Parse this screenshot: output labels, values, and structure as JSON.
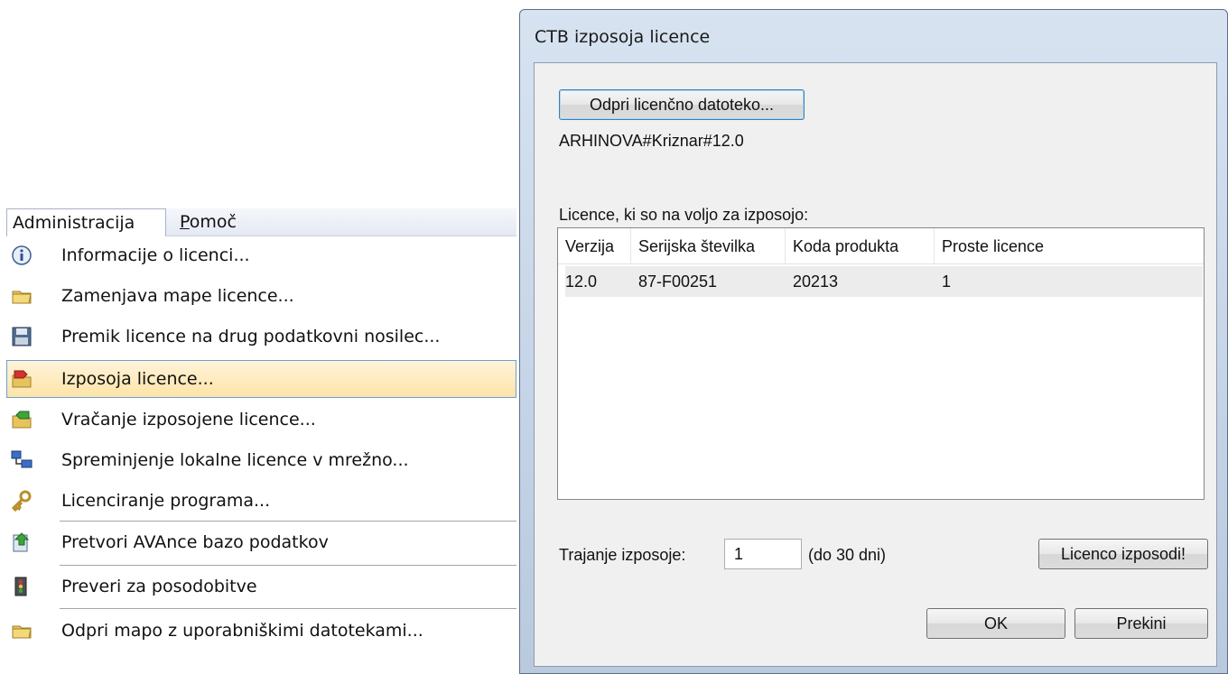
{
  "menubar": {
    "tabs": [
      {
        "label": "Administracija"
      },
      {
        "label_first": "P",
        "label_rest": "omoč"
      }
    ]
  },
  "menu": {
    "items": [
      {
        "label": "Informacije o licenci...",
        "icon": "info-icon"
      },
      {
        "label": "Zamenjava mape licence...",
        "icon": "folder-icon"
      },
      {
        "label": "Premik licence na drug podatkovni nosilec...",
        "icon": "floppy-disk-icon"
      },
      {
        "label": "Izposoja licence...",
        "icon": "folder-red-arrow-icon",
        "highlighted": true
      },
      {
        "label": "Vračanje izposojene licence...",
        "icon": "folder-green-arrow-icon"
      },
      {
        "label": "Spreminjenje lokalne licence v mrežno...",
        "icon": "network-computers-icon"
      },
      {
        "label": "Licenciranje programa...",
        "icon": "key-icon"
      },
      {
        "label": "Pretvori AVAnce bazo podatkov",
        "icon": "convert-database-icon"
      },
      {
        "label": "Preveri za posodobitve",
        "icon": "update-check-icon"
      },
      {
        "label": "Odpri mapo z uporabniškimi datotekami...",
        "icon": "folder-icon"
      }
    ]
  },
  "dialog": {
    "title": "CTB izposoja licence",
    "open_button": "Odpri licenčno datoteko...",
    "license_file": "ARHINOVA#Kriznar#12.0",
    "available_label": "Licence, ki so na voljo za izposojo:",
    "table": {
      "columns": [
        "Verzija",
        "Serijska številka",
        "Koda produkta",
        "Proste licence"
      ],
      "rows": [
        [
          "12.0",
          "87-F00251",
          "20213",
          "1"
        ]
      ]
    },
    "duration_label": "Trajanje izposoje:",
    "duration_value": "1",
    "duration_hint": "(do 30 dni)",
    "borrow_button": "Licenco izposodi!",
    "ok_button": "OK",
    "cancel_button": "Prekini"
  },
  "colors": {
    "highlight_bg": "#fde3a7",
    "highlight_border": "#6aa0d8",
    "title_bar": "#c4d3e6"
  }
}
